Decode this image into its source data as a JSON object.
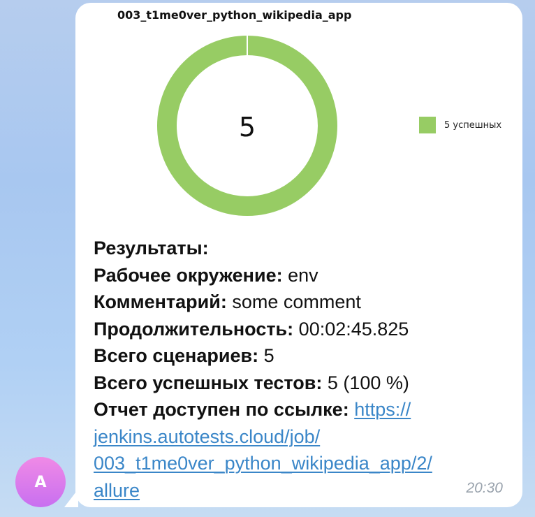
{
  "message": {
    "chart_title": "003_t1me0ver_python_wikipedia_app",
    "center_value": "5",
    "legend_label": "5 успешных",
    "passed_color": "#97cc64",
    "results_heading": "Результаты:",
    "env_label": "Рабочее окружение:",
    "env_value": "env",
    "comment_label": "Комментарий:",
    "comment_value": "some comment",
    "duration_label": "Продолжительность:",
    "duration_value": "00:02:45.825",
    "scenarios_label": "Всего сценариев:",
    "scenarios_value": "5",
    "passed_label": "Всего успешных тестов:",
    "passed_value": "5 (100 %)",
    "report_label": "Отчет доступен по ссылке:",
    "report_link_line1": "https://",
    "report_link_line2": "jenkins.autotests.cloud/job/",
    "report_link_line3": "003_t1me0ver_python_wikipedia_app/2/",
    "report_link_line4": "allure",
    "time": "20:30"
  },
  "sender": {
    "avatar_letter": "A"
  },
  "chart_data": {
    "type": "pie",
    "title": "003_t1me0ver_python_wikipedia_app",
    "center_label": "5",
    "categories": [
      "5 успешных"
    ],
    "values": [
      5
    ],
    "colors": [
      "#97cc64"
    ],
    "legend_position": "right"
  }
}
